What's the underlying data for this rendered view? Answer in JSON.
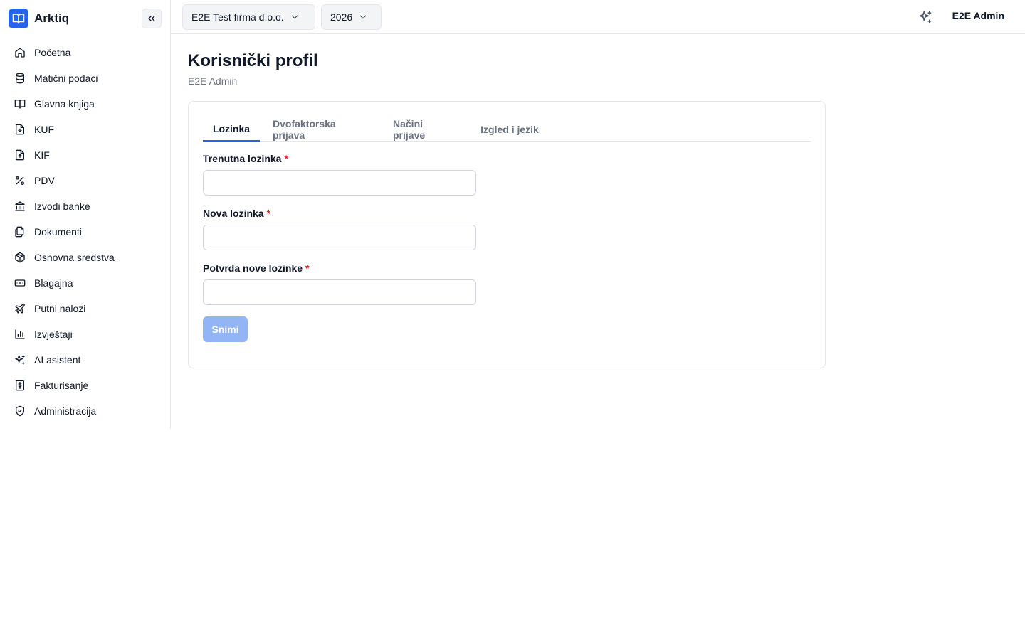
{
  "app": {
    "name": "Arktiq",
    "logo_icon": "book-open-icon",
    "brand_color": "#2563eb"
  },
  "sidebar": {
    "collapse_icon": "chevrons-left-icon",
    "items": [
      {
        "label": "Početna",
        "icon": "home-icon"
      },
      {
        "label": "Matični podaci",
        "icon": "database-icon"
      },
      {
        "label": "Glavna knjiga",
        "icon": "book-open-icon"
      },
      {
        "label": "KUF",
        "icon": "file-download-icon"
      },
      {
        "label": "KIF",
        "icon": "file-upload-icon"
      },
      {
        "label": "PDV",
        "icon": "percent-icon"
      },
      {
        "label": "Izvodi banke",
        "icon": "bank-icon"
      },
      {
        "label": "Dokumenti",
        "icon": "files-icon"
      },
      {
        "label": "Osnovna sredstva",
        "icon": "package-icon"
      },
      {
        "label": "Blagajna",
        "icon": "banknote-icon"
      },
      {
        "label": "Putni nalozi",
        "icon": "plane-icon"
      },
      {
        "label": "Izvještaji",
        "icon": "bar-chart-icon"
      },
      {
        "label": "AI asistent",
        "icon": "sparkles-icon"
      },
      {
        "label": "Fakturisanje",
        "icon": "receipt-dollar-icon"
      },
      {
        "label": "Administracija",
        "icon": "shield-check-icon"
      }
    ]
  },
  "topbar": {
    "company": "E2E Test firma d.o.o.",
    "year": "2026",
    "ai_icon": "sparkles-icon",
    "user": "E2E Admin"
  },
  "page": {
    "title": "Korisnički profil",
    "subtitle": "E2E Admin"
  },
  "tabs": [
    {
      "label": "Lozinka",
      "active": true
    },
    {
      "label": "Dvofaktorska prijava",
      "active": false
    },
    {
      "label": "Načini prijave",
      "active": false
    },
    {
      "label": "Izgled i jezik",
      "active": false
    }
  ],
  "form": {
    "current_password": {
      "label": "Trenutna lozinka",
      "required_mark": "*",
      "value": ""
    },
    "new_password": {
      "label": "Nova lozinka",
      "required_mark": "*",
      "value": ""
    },
    "confirm_password": {
      "label": "Potvrda nove lozinke",
      "required_mark": "*",
      "value": ""
    },
    "save_label": "Snimi",
    "save_disabled": true
  }
}
